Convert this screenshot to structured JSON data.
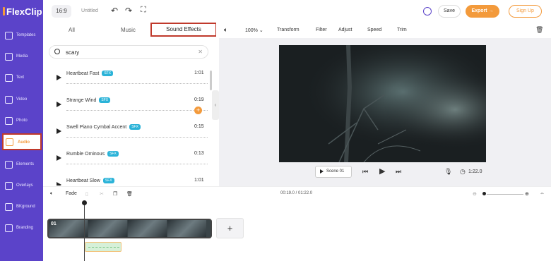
{
  "app": {
    "logo": "FlexClip"
  },
  "sidebar": {
    "items": [
      {
        "label": "Templates",
        "icon": "layers-icon"
      },
      {
        "label": "Media",
        "icon": "image-icon"
      },
      {
        "label": "Text",
        "icon": "text-icon"
      },
      {
        "label": "Video",
        "icon": "video-icon"
      },
      {
        "label": "Photo",
        "icon": "photo-icon"
      },
      {
        "label": "Audio",
        "icon": "music-note-icon",
        "active": true
      },
      {
        "label": "Elements",
        "icon": "grid-icon"
      },
      {
        "label": "Overlays",
        "icon": "overlay-icon"
      },
      {
        "label": "BKground",
        "icon": "background-icon"
      },
      {
        "label": "Branding",
        "icon": "brand-icon"
      }
    ]
  },
  "topbar": {
    "ratio": "16:9",
    "title": "Untitled",
    "save": "Save",
    "export": "Export →",
    "signup": "Sign Up"
  },
  "tabs": {
    "all": "All",
    "music": "Music",
    "sfx": "Sound Effects"
  },
  "search": {
    "value": "scary"
  },
  "sfx_list": [
    {
      "name": "Heartbeat Fast",
      "badge": "SFX",
      "duration": "1:01"
    },
    {
      "name": "Strange Wind",
      "badge": "SFX",
      "duration": "0:19"
    },
    {
      "name": "Swell Piano Cymbal Accent",
      "badge": "SFX",
      "duration": "0:15"
    },
    {
      "name": "Rumble Ominous",
      "badge": "SFX",
      "duration": "0:13"
    },
    {
      "name": "Heartbeat Slow",
      "badge": "SFX",
      "duration": "1:01"
    }
  ],
  "toolbar": {
    "zoom": "100%",
    "transform": "Transform",
    "filter": "Filter",
    "adjust": "Adjust",
    "speed": "Speed",
    "trim": "Trim"
  },
  "player": {
    "scene": "Scene 01",
    "duration": "1:22.0"
  },
  "timeline": {
    "fade": "Fade",
    "time": "00:19.0 / 01:22.0",
    "clip_number": "01",
    "add": "+"
  },
  "colors": {
    "brand": "#5b43c9",
    "accent": "#f39a3b",
    "highlight": "#c0392b"
  }
}
